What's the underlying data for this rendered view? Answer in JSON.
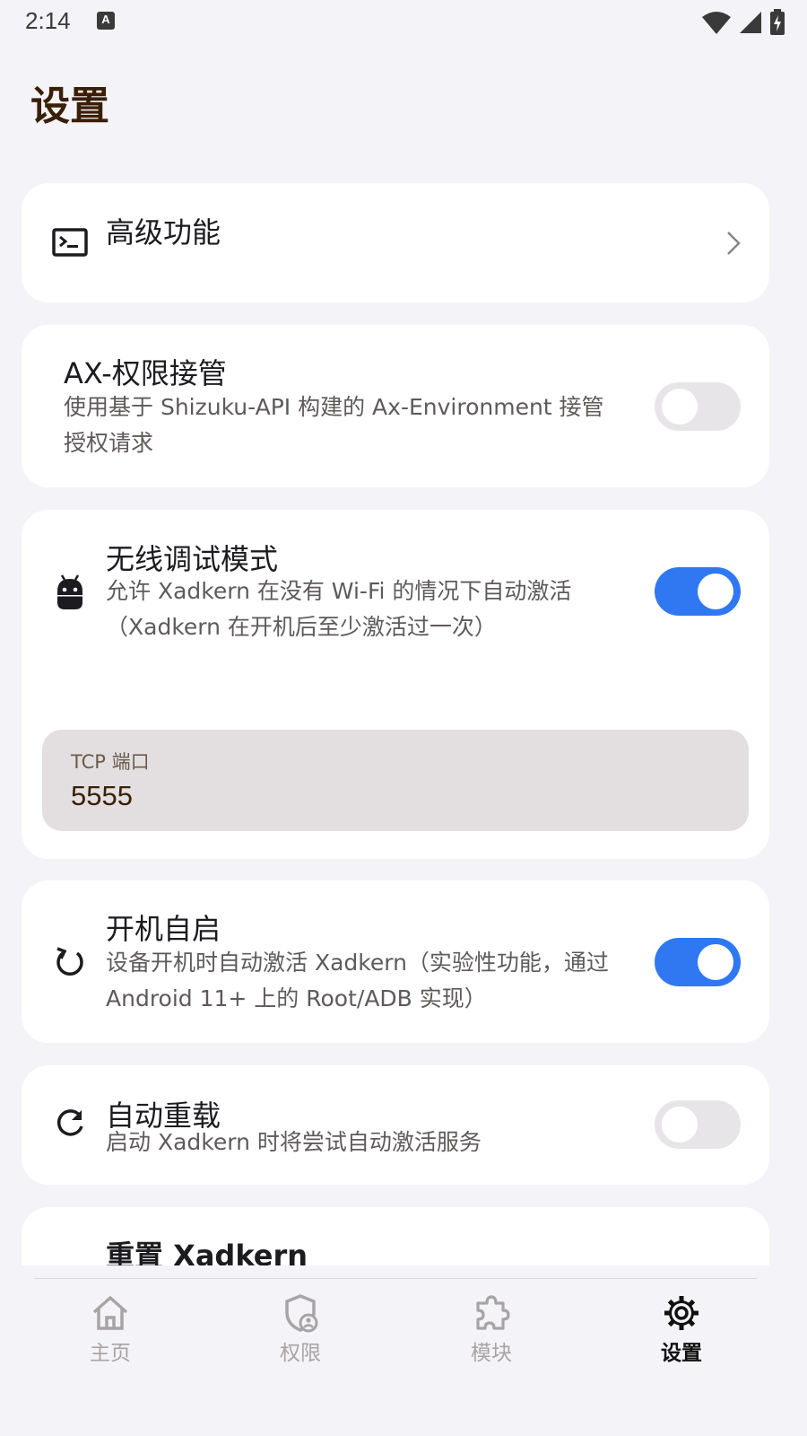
{
  "status_bar": {
    "time": "2:14",
    "notification_glyph": "A"
  },
  "page": {
    "title": "设置"
  },
  "advanced": {
    "title": "高级功能",
    "icon": "terminal-icon"
  },
  "ax_takeover": {
    "title": "AX-权限接管",
    "desc": "使用基于 Shizuku-API 构建的 Ax-Environment 接管授权请求",
    "enabled": false
  },
  "wireless_debug": {
    "title": "无线调试模式",
    "desc": "允许 Xadkern 在没有 Wi-Fi 的情况下自动激活（Xadkern 在开机后至少激活过一次）",
    "enabled": true,
    "tcp_label": "TCP 端口",
    "tcp_value": "5555",
    "icon": "android-icon"
  },
  "boot_start": {
    "title": "开机自启",
    "desc": "设备开机时自动激活 Xadkern（实验性功能，通过 Android 11+ 上的 Root/ADB 实现）",
    "enabled": true,
    "icon": "restart-icon"
  },
  "auto_reload": {
    "title": "自动重载",
    "desc": "启动 Xadkern 时将尝试自动激活服务",
    "enabled": false,
    "icon": "refresh-icon"
  },
  "reset": {
    "title": "重置 Xadkern"
  },
  "nav": {
    "items": [
      {
        "label": "主页",
        "icon": "home-icon",
        "active": false
      },
      {
        "label": "权限",
        "icon": "shield-person-icon",
        "active": false
      },
      {
        "label": "模块",
        "icon": "puzzle-icon",
        "active": false
      },
      {
        "label": "设置",
        "icon": "gear-icon",
        "active": true
      }
    ]
  },
  "colors": {
    "accent": "#2f78f2",
    "title": "#3a1f06",
    "background": "#f4f3f7",
    "card": "#ffffff"
  }
}
